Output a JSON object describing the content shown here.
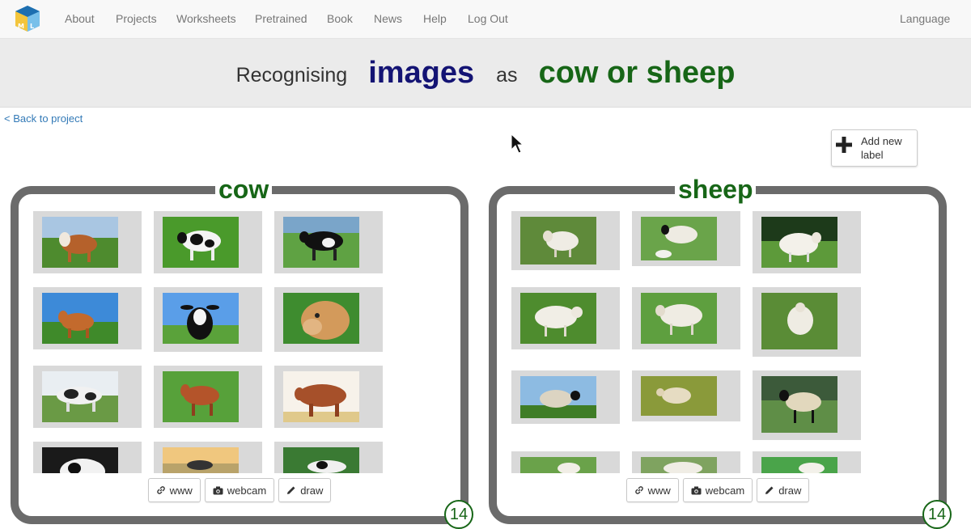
{
  "nav": {
    "items": [
      {
        "label": "About"
      },
      {
        "label": "Projects"
      },
      {
        "label": "Worksheets"
      },
      {
        "label": "Pretrained"
      },
      {
        "label": "Book"
      },
      {
        "label": "News"
      },
      {
        "label": "Help"
      },
      {
        "label": "Log Out"
      }
    ],
    "language": "Language"
  },
  "title": {
    "prefix": "Recognising",
    "type": "images",
    "as": "as",
    "labels": "cow or sheep"
  },
  "back_link": "< Back to project",
  "add_label": {
    "text": "Add new label",
    "icon": "plus-icon"
  },
  "buckets": [
    {
      "label": "cow",
      "count": "14",
      "images": [
        "brown cow in field",
        "black and white cow on grass",
        "black and white cow",
        "brown cow under blue sky",
        "black and white cow facing camera",
        "brown cow head",
        "holstein cow on grass",
        "red cow on grass",
        "brown cow on white background",
        "black and white cow",
        "cows at sunset",
        "black and white cow"
      ],
      "buttons": {
        "www": "www",
        "webcam": "webcam",
        "draw": "draw"
      }
    },
    {
      "label": "sheep",
      "count": "14",
      "images": [
        "white sheep in grass",
        "black faced sheep with lamb",
        "white sheep on grass",
        "white sheep on grass",
        "white sheep on grass",
        "white sheep in paddock",
        "sheep under blue sky",
        "sheep on grassy hill",
        "black faced sheep standing",
        "sheep on grass",
        "sheep lying down",
        "sheep on grass"
      ],
      "buttons": {
        "www": "www",
        "webcam": "webcam",
        "draw": "draw"
      }
    }
  ],
  "colors": {
    "type_color": "#141474",
    "label_color": "#176617",
    "bucket_border": "#6b6b6b",
    "tile_bg": "#d9d9d9"
  }
}
